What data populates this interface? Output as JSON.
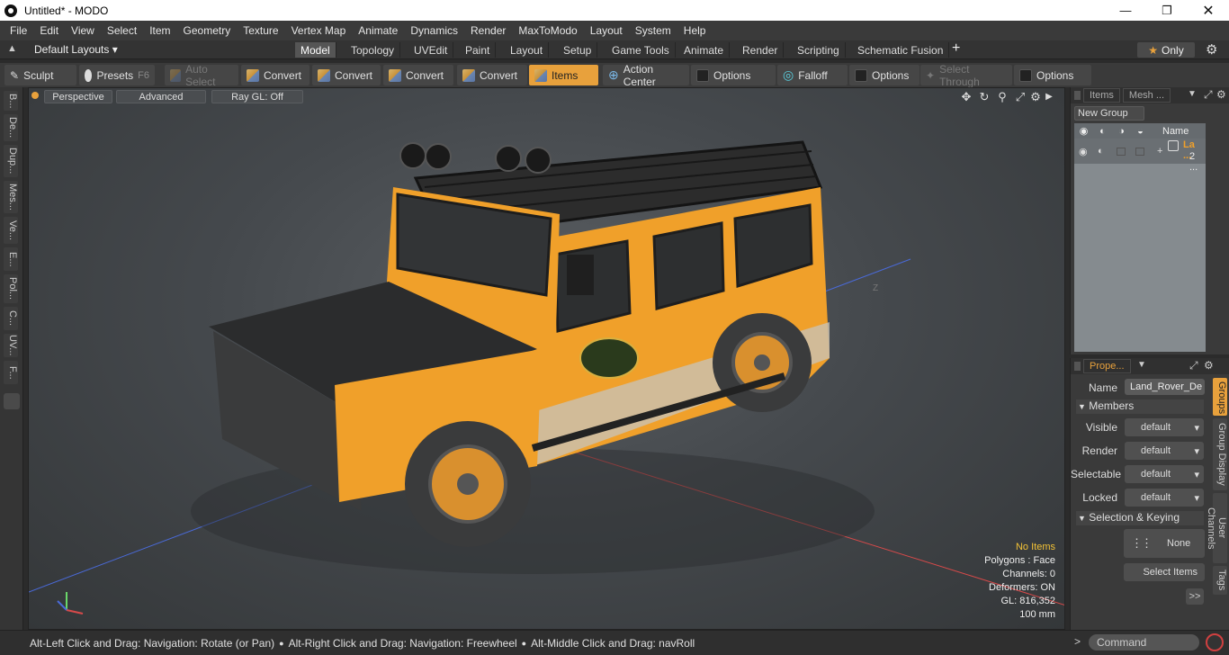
{
  "window": {
    "title": "Untitled* - MODO"
  },
  "menu": [
    "File",
    "Edit",
    "View",
    "Select",
    "Item",
    "Geometry",
    "Texture",
    "Vertex Map",
    "Animate",
    "Dynamics",
    "Render",
    "MaxToModo",
    "Layout",
    "System",
    "Help"
  ],
  "layout": {
    "selector": "Default Layouts",
    "tabs": [
      "Model",
      "Topology",
      "UVEdit",
      "Paint",
      "Layout",
      "Setup",
      "Game Tools",
      "Animate",
      "Render",
      "Scripting",
      "Schematic Fusion"
    ],
    "active_tab": "Model",
    "add": "+",
    "only": "Only"
  },
  "toolbar": {
    "sculpt": "Sculpt",
    "presets": "Presets",
    "presets_key": "F6",
    "auto_select": "Auto Select",
    "convert1": "Convert",
    "convert2": "Convert",
    "convert3": "Convert",
    "convert4": "Convert",
    "items": "Items",
    "action_center": "Action Center",
    "options1": "Options",
    "falloff": "Falloff",
    "options2": "Options",
    "select_through": "Select Through",
    "options3": "Options"
  },
  "left_tabs": [
    "B...",
    "De...",
    "Dup...",
    "Mes...",
    "Ve...",
    "E...",
    "Pol...",
    "C...",
    "UV...",
    "F..."
  ],
  "viewport": {
    "perspective": "Perspective",
    "advanced": "Advanced",
    "raygl": "Ray GL: Off",
    "axis_label": "Z",
    "stats": {
      "no_items": "No Items",
      "polygons": "Polygons : Face",
      "channels": "Channels: 0",
      "deformers": "Deformers: ON",
      "gl": "GL: 816,352",
      "scale": "100 mm"
    }
  },
  "items_panel": {
    "tabs": [
      "Items",
      "Mesh ..."
    ],
    "new_group": "New Group",
    "col_name": "Name",
    "row_name": "La ...",
    "row_count": "2 ..."
  },
  "properties_panel": {
    "tab": "Prope...",
    "name_label": "Name",
    "name_value": "Land_Rover_De",
    "members": "Members",
    "visible_label": "Visible",
    "visible_value": "default",
    "render_label": "Render",
    "render_value": "default",
    "selectable_label": "Selectable",
    "selectable_value": "default",
    "locked_label": "Locked",
    "locked_value": "default",
    "selection_keying": "Selection & Keying",
    "none": "None",
    "select_items": "Select Items",
    "more": ">>",
    "side_tabs": [
      "Groups",
      "Group Display",
      "User Channels",
      "Tags"
    ]
  },
  "statusbar": {
    "hint1": "Alt-Left Click and Drag: Navigation: Rotate (or Pan)",
    "hint2": "Alt-Right Click and Drag: Navigation: Freewheel",
    "hint3": "Alt-Middle Click and Drag: navRoll",
    "command_placeholder": "Command"
  },
  "colors": {
    "accent": "#e8a13c",
    "vehicle_body": "#f0a02a"
  }
}
